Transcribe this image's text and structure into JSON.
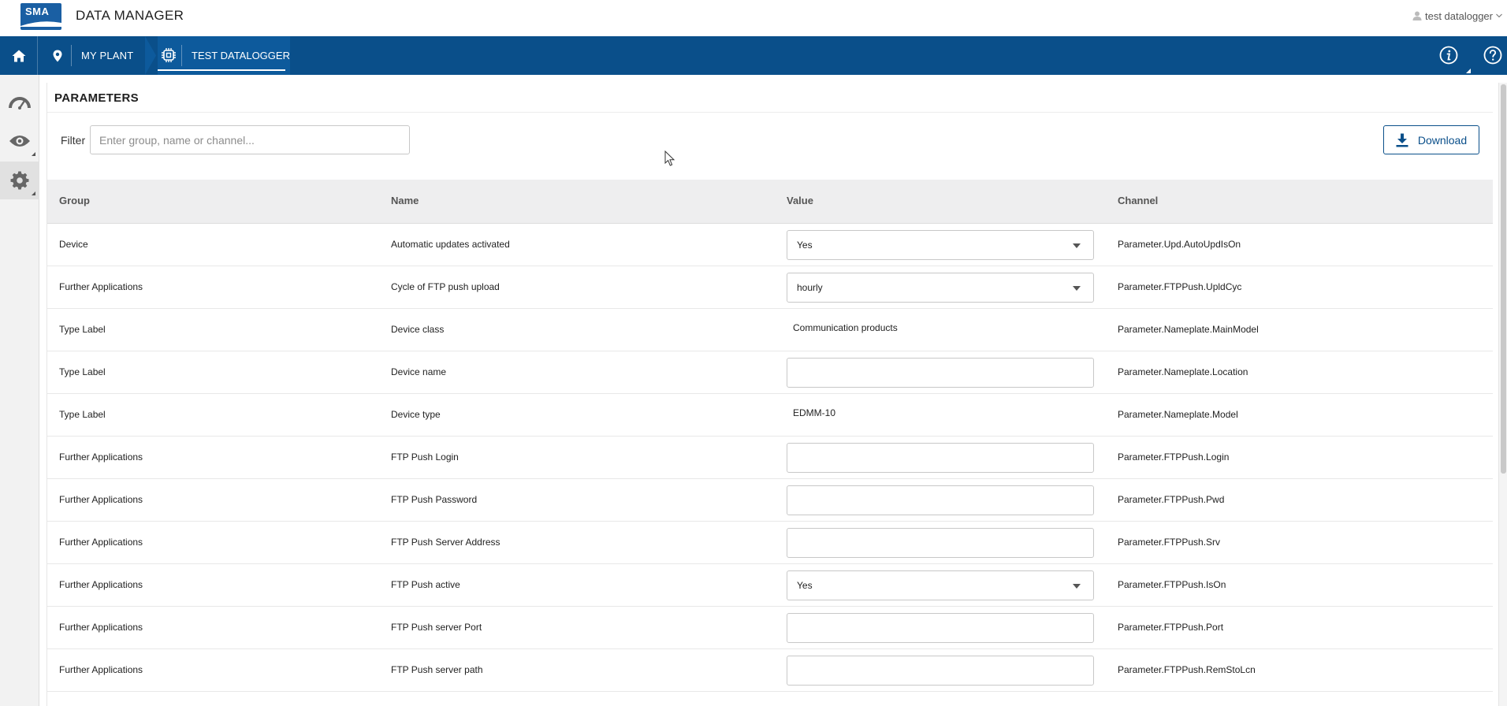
{
  "app": {
    "logo_text": "SMA",
    "title": "DATA MANAGER",
    "user": "test datalogger"
  },
  "nav": {
    "breadcrumbs": [
      {
        "label": "MY PLANT",
        "icon": "location-pin-icon"
      },
      {
        "label": "TEST DATALOGGER",
        "icon": "chip-icon",
        "active": true
      }
    ],
    "right_icons": [
      "info-icon",
      "help-icon"
    ]
  },
  "rail": {
    "items": [
      {
        "icon": "gauge-icon"
      },
      {
        "icon": "eye-icon"
      },
      {
        "icon": "gear-icon",
        "active": true
      }
    ]
  },
  "page": {
    "title": "PARAMETERS",
    "filter_label": "Filter",
    "filter_placeholder": "Enter group, name or channel...",
    "filter_value": "",
    "download_label": "Download"
  },
  "table": {
    "headers": {
      "group": "Group",
      "name": "Name",
      "value": "Value",
      "channel": "Channel"
    },
    "rows": [
      {
        "group": "Device",
        "name": "Automatic updates activated",
        "value_type": "select",
        "value": "Yes",
        "channel": "Parameter.Upd.AutoUpdIsOn"
      },
      {
        "group": "Further Applications",
        "name": "Cycle of FTP push upload",
        "value_type": "select",
        "value": "hourly",
        "channel": "Parameter.FTPPush.UpldCyc"
      },
      {
        "group": "Type Label",
        "name": "Device class",
        "value_type": "text",
        "value": "Communication products",
        "channel": "Parameter.Nameplate.MainModel"
      },
      {
        "group": "Type Label",
        "name": "Device name",
        "value_type": "input",
        "value": "",
        "channel": "Parameter.Nameplate.Location"
      },
      {
        "group": "Type Label",
        "name": "Device type",
        "value_type": "text",
        "value": "EDMM-10",
        "channel": "Parameter.Nameplate.Model"
      },
      {
        "group": "Further Applications",
        "name": "FTP Push Login",
        "value_type": "input",
        "value": "",
        "channel": "Parameter.FTPPush.Login"
      },
      {
        "group": "Further Applications",
        "name": "FTP Push Password",
        "value_type": "input",
        "value": "",
        "channel": "Parameter.FTPPush.Pwd"
      },
      {
        "group": "Further Applications",
        "name": "FTP Push Server Address",
        "value_type": "input",
        "value": "",
        "channel": "Parameter.FTPPush.Srv"
      },
      {
        "group": "Further Applications",
        "name": "FTP Push active",
        "value_type": "select",
        "value": "Yes",
        "channel": "Parameter.FTPPush.IsOn"
      },
      {
        "group": "Further Applications",
        "name": "FTP Push server Port",
        "value_type": "input",
        "value": "",
        "channel": "Parameter.FTPPush.Port"
      },
      {
        "group": "Further Applications",
        "name": "FTP Push server path",
        "value_type": "input",
        "value": "",
        "channel": "Parameter.FTPPush.RemStoLcn"
      }
    ]
  },
  "colors": {
    "nav_bg": "#0a4f8a",
    "accent": "#0a4f8a",
    "header_bg": "#eeeeef"
  }
}
